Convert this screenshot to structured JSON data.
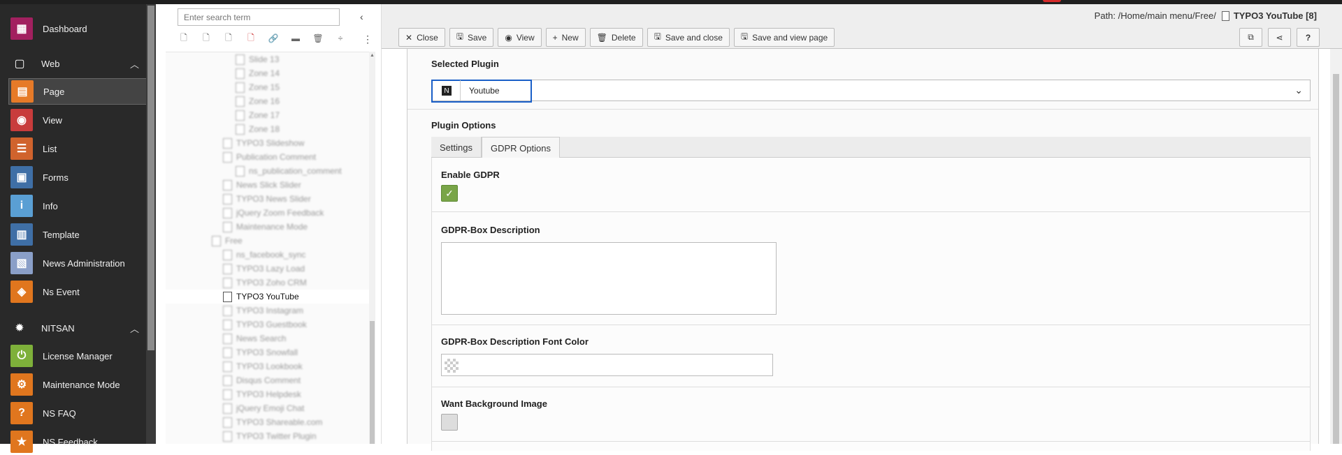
{
  "module_menu": {
    "items": [
      {
        "label": "Dashboard",
        "icon": "dashboard-icon",
        "color": "#a2205f"
      },
      {
        "label": "Page",
        "icon": "page-icon",
        "color": "#e67a28"
      },
      {
        "label": "View",
        "icon": "eye-icon",
        "color": "#c83c3c"
      },
      {
        "label": "List",
        "icon": "list-icon",
        "color": "#d0632d"
      },
      {
        "label": "Forms",
        "icon": "forms-icon",
        "color": "#3f6fa6"
      },
      {
        "label": "Info",
        "icon": "info-icon",
        "color": "#5a9fd4"
      },
      {
        "label": "Template",
        "icon": "template-icon",
        "color": "#3f6fa6"
      },
      {
        "label": "News Administration",
        "icon": "news-icon",
        "color": "#8a9fc8"
      },
      {
        "label": "Ns Event",
        "icon": "event-icon",
        "color": "#e0761e"
      },
      {
        "label": "License Manager",
        "icon": "power-icon",
        "color": "#7eb03a"
      },
      {
        "label": "Maintenance Mode",
        "icon": "gear-icon",
        "color": "#e0761e"
      },
      {
        "label": "NS FAQ",
        "icon": "faq-icon",
        "color": "#e0761e"
      },
      {
        "label": "NS Feedback",
        "icon": "star-icon",
        "color": "#e0761e"
      }
    ],
    "groups": [
      {
        "label": "Web"
      },
      {
        "label": "NITSAN"
      }
    ]
  },
  "tree": {
    "search_placeholder": "Enter search term",
    "selected_label": "TYPO3 YouTube",
    "blurred": [
      "Slide 13",
      "Zone 14",
      "Zone 15",
      "Zone 16",
      "Zone 17",
      "Zone 18",
      "TYPO3 Slideshow",
      "Publication Comment",
      "ns_publication_comment",
      "News Slick Slider",
      "TYPO3 News Slider",
      "jQuery Zoom Feedback",
      "Maintenance Mode",
      "Free",
      "ns_facebook_sync",
      "TYPO3 Lazy Load",
      "TYPO3 Zoho CRM",
      "",
      "TYPO3 Instagram",
      "TYPO3 Guestbook",
      "News Search",
      "TYPO3 Snowfall",
      "TYPO3 Lookbook",
      "Disqus Comment",
      "TYPO3 Helpdesk",
      "jQuery Emoji Chat",
      "TYPO3 Shareable.com",
      "TYPO3 Twitter Plugin"
    ]
  },
  "header": {
    "path_prefix": "Path: /Home/main menu/Free/",
    "path_title": "TYPO3 YouTube [8]",
    "buttons": {
      "close": "Close",
      "save": "Save",
      "view": "View",
      "new": "New",
      "delete": "Delete",
      "save_close": "Save and close",
      "save_view": "Save and view page"
    }
  },
  "form": {
    "selected_plugin_label": "Selected Plugin",
    "plugin_value": "Youtube",
    "plugin_options_label": "Plugin Options",
    "tabs": [
      "Settings",
      "GDPR Options"
    ],
    "fields": {
      "enable_gdpr": "Enable GDPR",
      "gdpr_description": "GDPR-Box Description",
      "gdpr_font_color": "GDPR-Box Description Font Color",
      "want_bg_image": "Want Background Image"
    }
  }
}
